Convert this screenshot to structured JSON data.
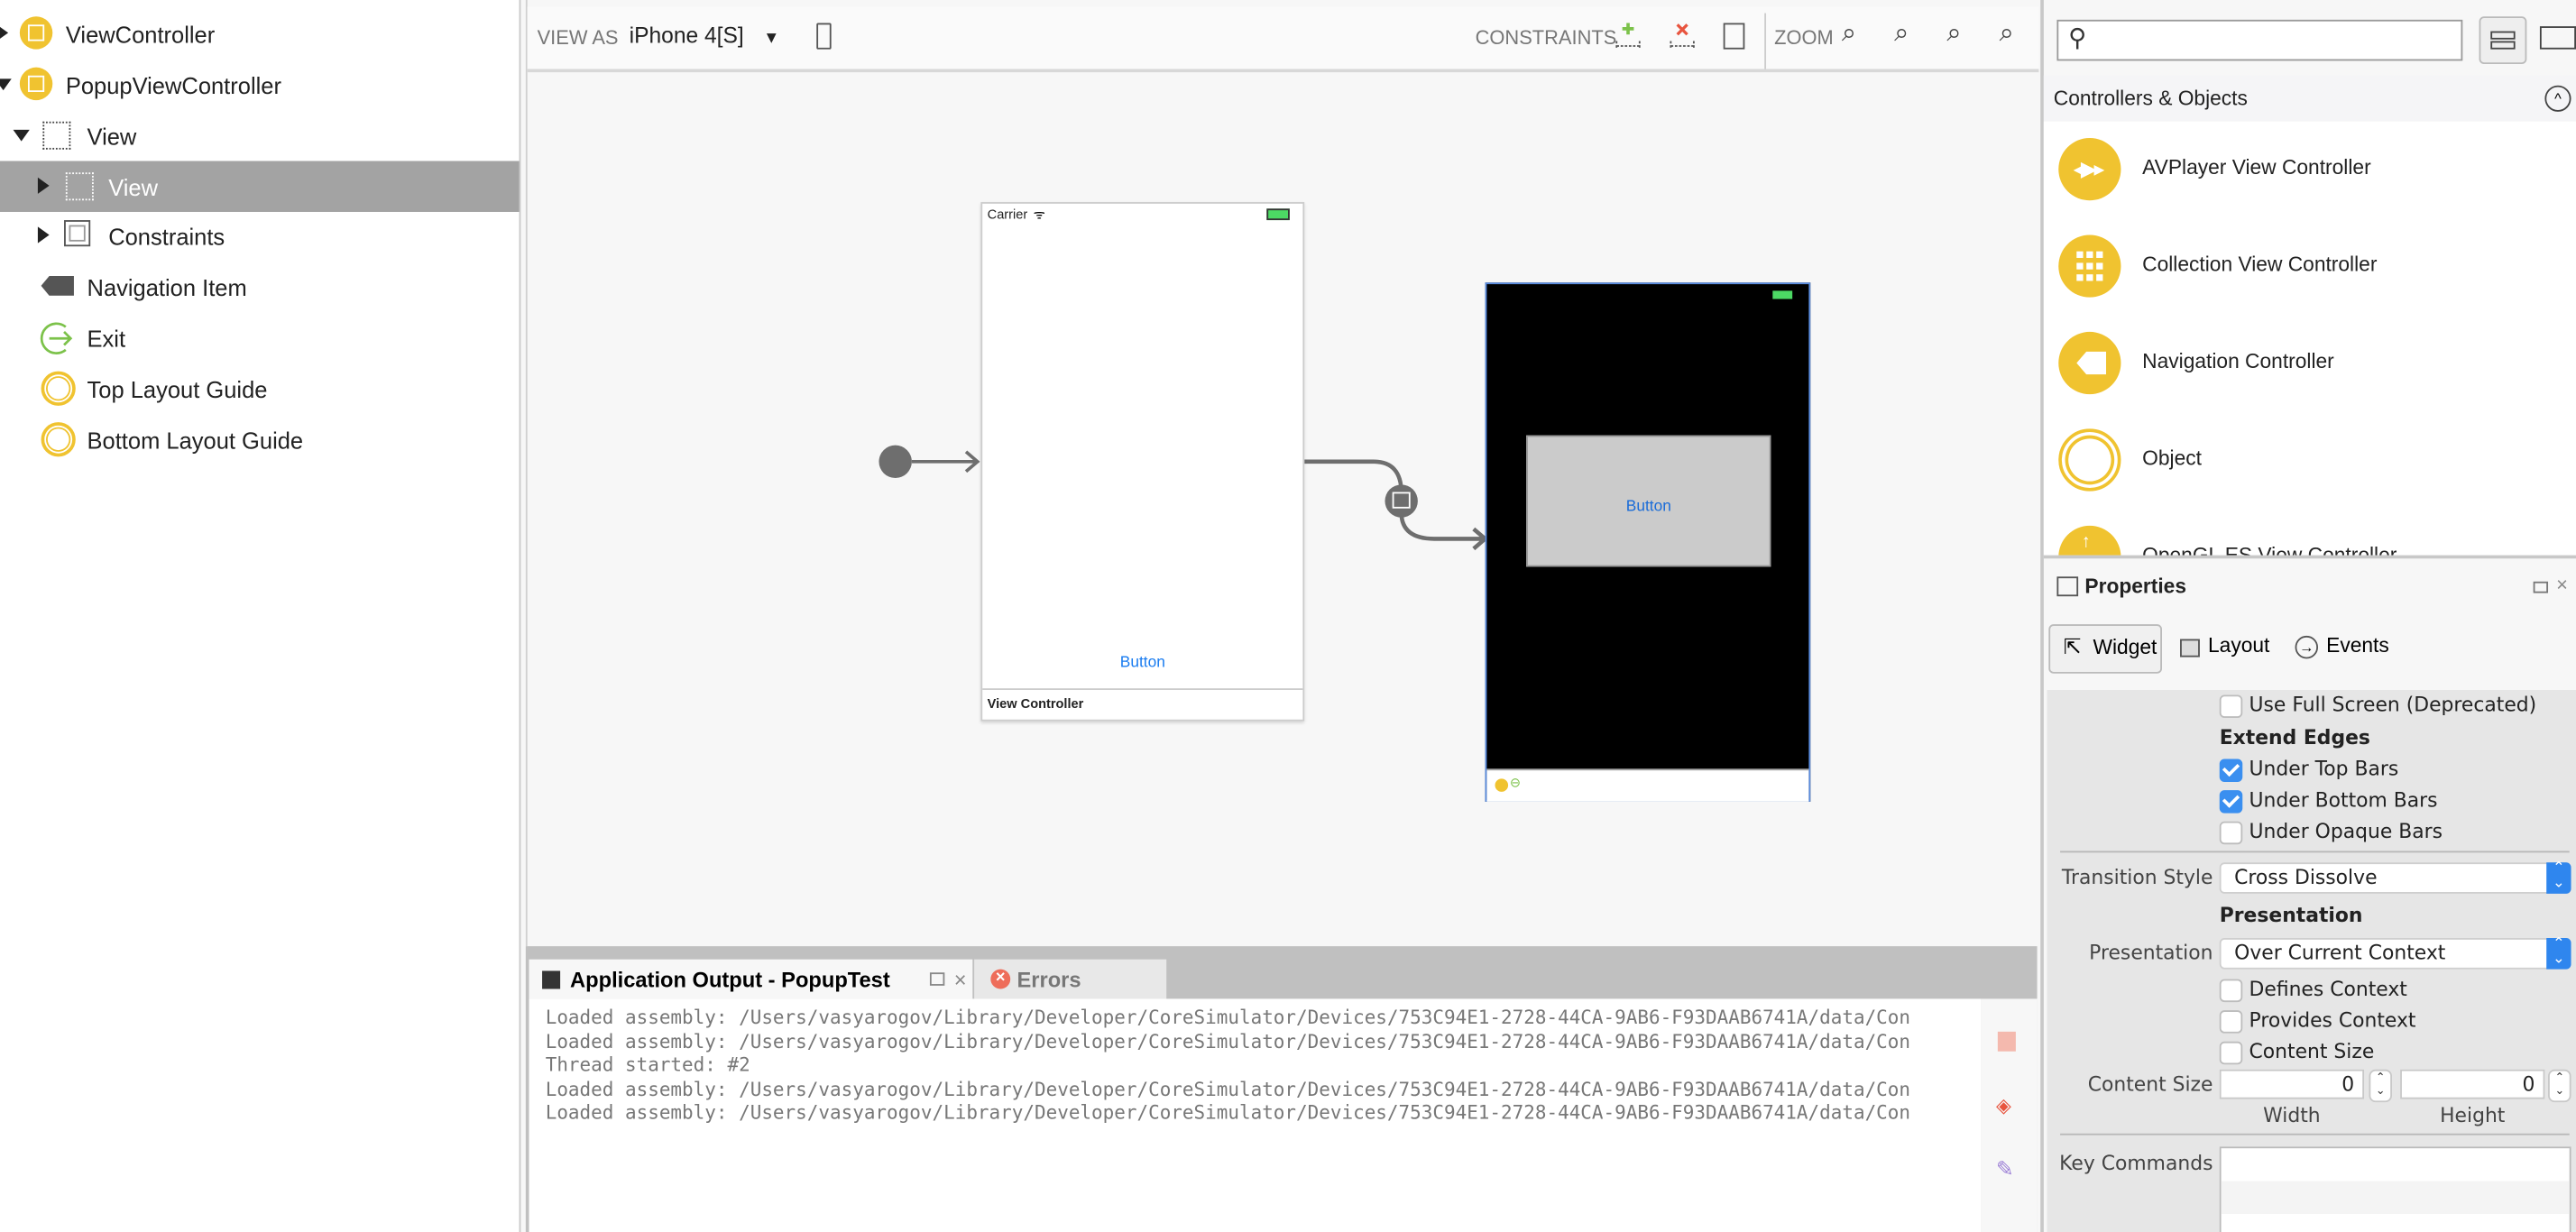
{
  "outline": {
    "items": [
      {
        "label": "ViewController",
        "icon": "view-controller-icon",
        "expander": "collapsed"
      },
      {
        "label": "PopupViewController",
        "icon": "view-controller-icon",
        "expander": "expanded"
      },
      {
        "label": "View",
        "icon": "view-icon",
        "expander": "expanded"
      },
      {
        "label": "View",
        "icon": "view-icon",
        "expander": "collapsed",
        "selected": true
      },
      {
        "label": "Constraints",
        "icon": "constraints-icon",
        "expander": "collapsed"
      },
      {
        "label": "Navigation Item",
        "icon": "navigation-item-icon"
      },
      {
        "label": "Exit",
        "icon": "exit-icon"
      },
      {
        "label": "Top Layout Guide",
        "icon": "layout-guide-icon"
      },
      {
        "label": "Bottom Layout Guide",
        "icon": "layout-guide-icon"
      }
    ]
  },
  "toolbar": {
    "view_as_label": "VIEW AS",
    "device": "iPhone 4[S]",
    "constraints_label": "CONSTRAINTS",
    "zoom_label": "ZOOM"
  },
  "canvas": {
    "scene1": {
      "carrier": "Carrier",
      "button": "Button",
      "footer": "View Controller"
    },
    "scene2": {
      "button": "Button"
    }
  },
  "pad": {
    "tabs": [
      {
        "label": "Application Output - PopupTest",
        "active": true
      },
      {
        "label": "Errors",
        "active": false
      }
    ],
    "output_lines": [
      "Loaded assembly: /Users/vasyarogov/Library/Developer/CoreSimulator/Devices/753C94E1-2728-44CA-9AB6-F93DAAB6741A/data/Con",
      "Loaded assembly: /Users/vasyarogov/Library/Developer/CoreSimulator/Devices/753C94E1-2728-44CA-9AB6-F93DAAB6741A/data/Con",
      "Thread started:  #2",
      "Loaded assembly: /Users/vasyarogov/Library/Developer/CoreSimulator/Devices/753C94E1-2728-44CA-9AB6-F93DAAB6741A/data/Con",
      "Loaded assembly: /Users/vasyarogov/Library/Developer/CoreSimulator/Devices/753C94E1-2728-44CA-9AB6-F93DAAB6741A/data/Con"
    ]
  },
  "toolbox": {
    "search_value": "",
    "section_title": "Controllers & Objects",
    "items": [
      {
        "label": "AVPlayer View Controller",
        "icon": "avplayer-icon"
      },
      {
        "label": "Collection View Controller",
        "icon": "collection-grid-icon"
      },
      {
        "label": "Navigation Controller",
        "icon": "navigation-controller-icon"
      },
      {
        "label": "Object",
        "icon": "object-icon"
      },
      {
        "label": "OpenGL ES View Controller",
        "icon": "opengl-icon"
      }
    ]
  },
  "properties": {
    "title": "Properties",
    "tabs": [
      {
        "label": "Widget",
        "active": true
      },
      {
        "label": "Layout",
        "active": false
      },
      {
        "label": "Events",
        "active": false
      }
    ],
    "use_full_screen": {
      "label": "Use Full Screen (Deprecated)",
      "checked": false
    },
    "extend_edges_heading": "Extend Edges",
    "under_top_bars": {
      "label": "Under Top Bars",
      "checked": true
    },
    "under_bottom_bars": {
      "label": "Under Bottom Bars",
      "checked": true
    },
    "under_opaque_bars": {
      "label": "Under Opaque Bars",
      "checked": false
    },
    "transition_style_label": "Transition Style",
    "transition_style_value": "Cross Dissolve",
    "presentation_heading": "Presentation",
    "presentation_label": "Presentation",
    "presentation_value": "Over Current Context",
    "defines_context": {
      "label": "Defines Context",
      "checked": false
    },
    "provides_context": {
      "label": "Provides Context",
      "checked": false
    },
    "content_size_check": {
      "label": "Content Size",
      "checked": false
    },
    "content_size_label": "Content Size",
    "width_value": "0",
    "height_value": "0",
    "width_label": "Width",
    "height_label": "Height",
    "key_commands_label": "Key Commands"
  },
  "colors": {
    "accent": "#2f86ee",
    "object_yellow": "#f0c330",
    "selection": "#a3a3a3",
    "ios_blue": "#1a7cf0"
  }
}
